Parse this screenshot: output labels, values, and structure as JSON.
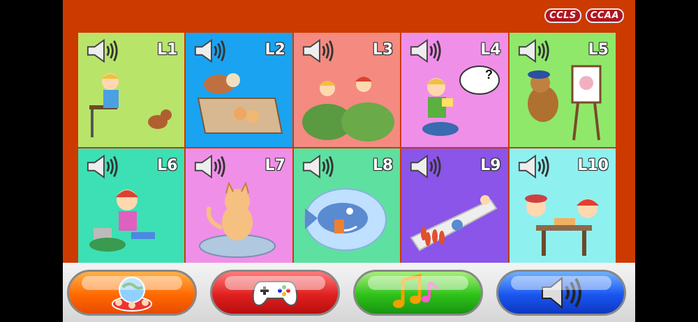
{
  "header": {
    "badges": [
      "CCLS",
      "CCAA"
    ]
  },
  "levels": [
    {
      "label": "L1",
      "color": "#b9e46a",
      "scene": "boy-at-desk-with-dog"
    },
    {
      "label": "L2",
      "color": "#1aa3f0",
      "scene": "dog-and-kittens-in-box"
    },
    {
      "label": "L3",
      "color": "#f48a80",
      "scene": "girls-behind-bushes"
    },
    {
      "label": "L4",
      "color": "#f08fe8",
      "scene": "boy-reading-note"
    },
    {
      "label": "L5",
      "color": "#8fe86a",
      "scene": "dog-painter-with-easel"
    },
    {
      "label": "L6",
      "color": "#3ce0b4",
      "scene": "girl-with-paint-can"
    },
    {
      "label": "L7",
      "color": "#f08fe8",
      "scene": "kitten-on-cushion"
    },
    {
      "label": "L8",
      "color": "#5ee0a0",
      "scene": "fish-in-bubble"
    },
    {
      "label": "L9",
      "color": "#8a55e8",
      "scene": "bowling-pins"
    },
    {
      "label": "L10",
      "color": "#8ff0f0",
      "scene": "kids-at-table"
    }
  ],
  "toolbar": {
    "buttons": [
      {
        "name": "home-button",
        "icon": "globe-kids-icon"
      },
      {
        "name": "games-button",
        "icon": "gamepad-icon"
      },
      {
        "name": "music-button",
        "icon": "music-notes-icon"
      },
      {
        "name": "sound-button",
        "icon": "speaker-icon"
      }
    ]
  }
}
